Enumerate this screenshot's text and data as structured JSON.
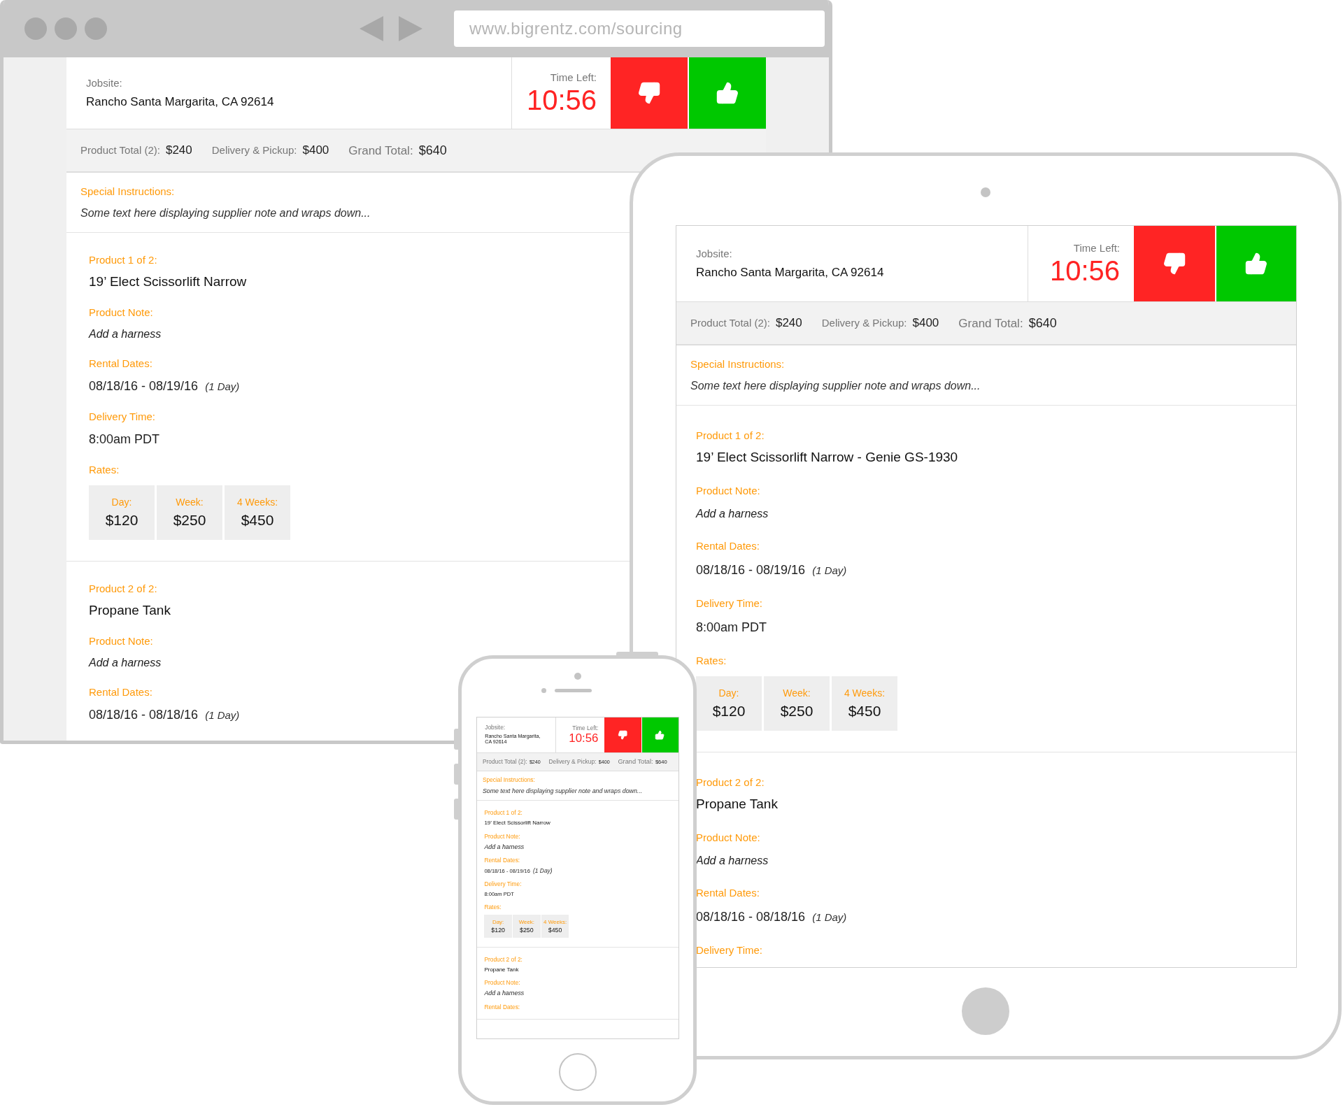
{
  "browser": {
    "url": "www.bigrentz.com/sourcing",
    "app": {
      "jobsite": {
        "label": "Jobsite:",
        "value": "Rancho Santa Margarita, CA 92614"
      },
      "timer": {
        "label": "Time Left:",
        "value": "10:56"
      },
      "actions": [
        {
          "kind": "reject"
        },
        {
          "kind": "accept"
        }
      ],
      "totals": [
        {
          "label": "Product Total (2):",
          "value": "$240"
        },
        {
          "label": "Delivery & Pickup:",
          "value": "$400"
        },
        {
          "label": "Grand Total:",
          "value": "$640"
        }
      ],
      "instructions": {
        "label": "Special Instructions:",
        "text": "Some text here displaying supplier note and wraps down..."
      },
      "products": [
        {
          "heading": "Product 1 of 2:",
          "name": "19’ Elect Scissorlift Narrow",
          "details": [
            {
              "kind": "note",
              "label": "Product Note:",
              "value": "Add a harness"
            },
            {
              "kind": "text",
              "label": "Rental Dates:",
              "value": "08/18/16 - 08/19/16",
              "extra": "(1 Day)"
            },
            {
              "kind": "text",
              "label": "Delivery Time:",
              "value": "8:00am PDT"
            }
          ],
          "rates": {
            "label": "Rates:",
            "items": [
              {
                "label": "Day:",
                "value": "$120"
              },
              {
                "label": "Week:",
                "value": "$250"
              },
              {
                "label": "4 Weeks:",
                "value": "$450"
              }
            ]
          }
        },
        {
          "heading": "Product 2 of 2:",
          "name": "Propane Tank",
          "details": [
            {
              "kind": "note",
              "label": "Product Note:",
              "value": "Add a harness"
            },
            {
              "kind": "text",
              "label": "Rental Dates:",
              "value": "08/18/16 - 08/18/16",
              "extra": "(1 Day)"
            }
          ]
        }
      ]
    }
  },
  "tablet": {
    "app": {
      "jobsite": {
        "label": "Jobsite:",
        "value": "Rancho Santa Margarita, CA 92614"
      },
      "timer": {
        "label": "Time Left:",
        "value": "10:56"
      },
      "actions": [
        {
          "kind": "reject"
        },
        {
          "kind": "accept"
        }
      ],
      "totals": [
        {
          "label": "Product Total (2):",
          "value": "$240"
        },
        {
          "label": "Delivery & Pickup:",
          "value": "$400"
        },
        {
          "label": "Grand Total:",
          "value": "$640"
        }
      ],
      "instructions": {
        "label": "Special Instructions:",
        "text": "Some text here displaying supplier note and wraps down..."
      },
      "products": [
        {
          "heading": "Product 1 of 2:",
          "name": "19’ Elect Scissorlift Narrow - Genie GS-1930",
          "details": [
            {
              "kind": "note",
              "label": "Product Note:",
              "value": "Add a harness"
            },
            {
              "kind": "text",
              "label": "Rental Dates:",
              "value": "08/18/16 - 08/19/16",
              "extra": "(1 Day)"
            },
            {
              "kind": "text",
              "label": "Delivery Time:",
              "value": "8:00am PDT"
            }
          ],
          "rates": {
            "label": "Rates:",
            "items": [
              {
                "label": "Day:",
                "value": "$120"
              },
              {
                "label": "Week:",
                "value": "$250"
              },
              {
                "label": "4 Weeks:",
                "value": "$450"
              }
            ]
          }
        },
        {
          "heading": "Product 2 of 2:",
          "name": "Propane Tank",
          "details": [
            {
              "kind": "note",
              "label": "Product Note:",
              "value": "Add a harness"
            },
            {
              "kind": "text",
              "label": "Rental Dates:",
              "value": "08/18/16 - 08/18/16",
              "extra": "(1 Day)"
            },
            {
              "label": "Delivery Time:"
            }
          ]
        }
      ]
    }
  },
  "phone": {
    "app": {
      "jobsite": {
        "label": "Jobsite:",
        "value": "Rancho Santa Margarita, CA 92614"
      },
      "timer": {
        "label": "Time Left:",
        "value": "10:56"
      },
      "actions": [
        {
          "kind": "reject"
        },
        {
          "kind": "accept"
        }
      ],
      "totals": [
        {
          "label": "Product Total (2):",
          "value": "$240"
        },
        {
          "label": "Delivery & Pickup:",
          "value": "$400"
        },
        {
          "label": "Grand Total:",
          "value": "$640"
        }
      ],
      "instructions": {
        "label": "Special Instructions:",
        "text": "Some text here displaying supplier note and wraps down..."
      },
      "products": [
        {
          "heading": "Product 1 of 2:",
          "name": "19’ Elect Scissorlift Narrow",
          "details": [
            {
              "kind": "note",
              "label": "Product Note:",
              "value": "Add a harness"
            },
            {
              "kind": "text",
              "label": "Rental Dates:",
              "value": "08/18/16 - 08/19/16",
              "extra": "(1 Day)"
            },
            {
              "kind": "text",
              "label": "Delivery Time:",
              "value": "8:00am PDT"
            }
          ],
          "rates": {
            "label": "Rates:",
            "items": [
              {
                "label": "Day:",
                "value": "$120"
              },
              {
                "label": "Week:",
                "value": "$250"
              },
              {
                "label": "4 Weeks:",
                "value": "$450"
              }
            ]
          }
        },
        {
          "heading": "Product 2 of 2:",
          "name": "Propane Tank",
          "details": [
            {
              "kind": "note",
              "label": "Product Note:",
              "value": "Add a harness"
            },
            {
              "label": "Rental Dates:"
            }
          ]
        }
      ]
    }
  }
}
